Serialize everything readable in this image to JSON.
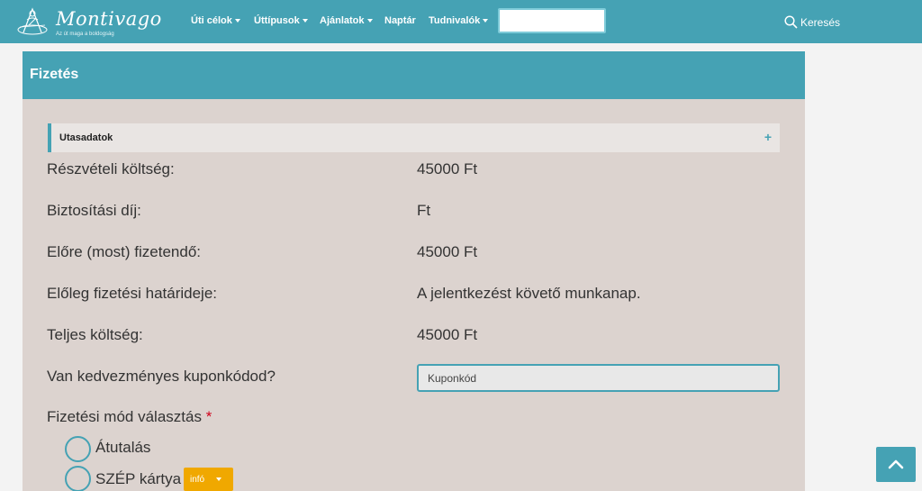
{
  "brand": {
    "name": "Montivago",
    "tagline": "Az út maga a boldogság"
  },
  "nav": {
    "items": [
      {
        "label": "Úti célok",
        "dropdown": true
      },
      {
        "label": "Úttípusok",
        "dropdown": true
      },
      {
        "label": "Ajánlatok",
        "dropdown": true
      },
      {
        "label": "Naptár",
        "dropdown": false
      },
      {
        "label": "Tudnivalók",
        "dropdown": true
      }
    ],
    "search_input_value": "",
    "search_label": "Keresés"
  },
  "card": {
    "title": "Fizetés",
    "accordion": {
      "label": "Utasadatok",
      "toggle": "+"
    },
    "rows": [
      {
        "label": "Részvételi költség:",
        "value": "45000 Ft"
      },
      {
        "label": "Biztosítási díj:",
        "value": "Ft"
      },
      {
        "label": "Előre (most) fizetendő:",
        "value": "45000 Ft"
      },
      {
        "label": "Előleg fizetési határideje:",
        "value": "A jelentkezést követő munkanap."
      },
      {
        "label": "Teljes költség:",
        "value": "45000 Ft"
      }
    ],
    "coupon": {
      "label": "Van kedvezményes kuponkódod?",
      "placeholder": "Kuponkód",
      "value": ""
    },
    "payment": {
      "label": "Fizetési mód választás",
      "required_mark": "*",
      "options": [
        {
          "label": "Átutalás",
          "selected": false
        },
        {
          "label": "SZÉP kártya",
          "selected": false
        }
      ],
      "info_button": "infó"
    }
  },
  "colors": {
    "primary": "#45a2b4",
    "card_bg": "#dcd3cf",
    "info_button": "#f0a800",
    "required": "#d0021b"
  },
  "icons": {
    "search": "search-icon",
    "scroll_top": "chevron-up-icon",
    "nav_dropdown": "caret-down-icon"
  }
}
